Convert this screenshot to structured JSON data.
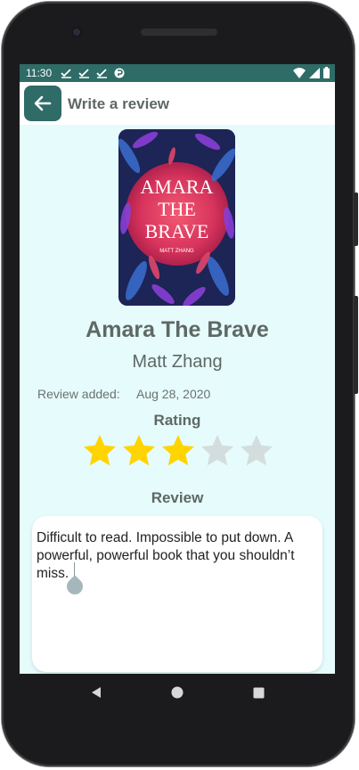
{
  "status": {
    "time": "11:30",
    "icons": [
      "check-download-icon",
      "check-download-icon",
      "check-download-icon",
      "app-notification-icon"
    ],
    "right_icons": [
      "wifi-icon",
      "signal-icon",
      "battery-icon"
    ]
  },
  "appbar": {
    "title": "Write a review",
    "back_icon": "arrow-left-icon"
  },
  "book": {
    "cover_title_lines": [
      "AMARA",
      "THE",
      "BRAVE"
    ],
    "cover_author": "MATT ZHANG",
    "title": "Amara The Brave",
    "author": "Matt Zhang"
  },
  "review_meta": {
    "added_label": "Review added:",
    "added_date": "Aug 28, 2020"
  },
  "rating": {
    "label": "Rating",
    "value": 3,
    "max": 5,
    "filled_color": "#FFD400",
    "empty_color": "#D3DDDE"
  },
  "review": {
    "label": "Review",
    "text": "Difficult to read. Impossible to put down. A powerful, powerful book that you shouldn’t miss."
  },
  "colors": {
    "accent": "#2F6B67",
    "background": "#E6FBFB"
  },
  "navbar": {
    "icons": [
      "back-triangle-icon",
      "home-circle-icon",
      "recents-square-icon"
    ]
  }
}
